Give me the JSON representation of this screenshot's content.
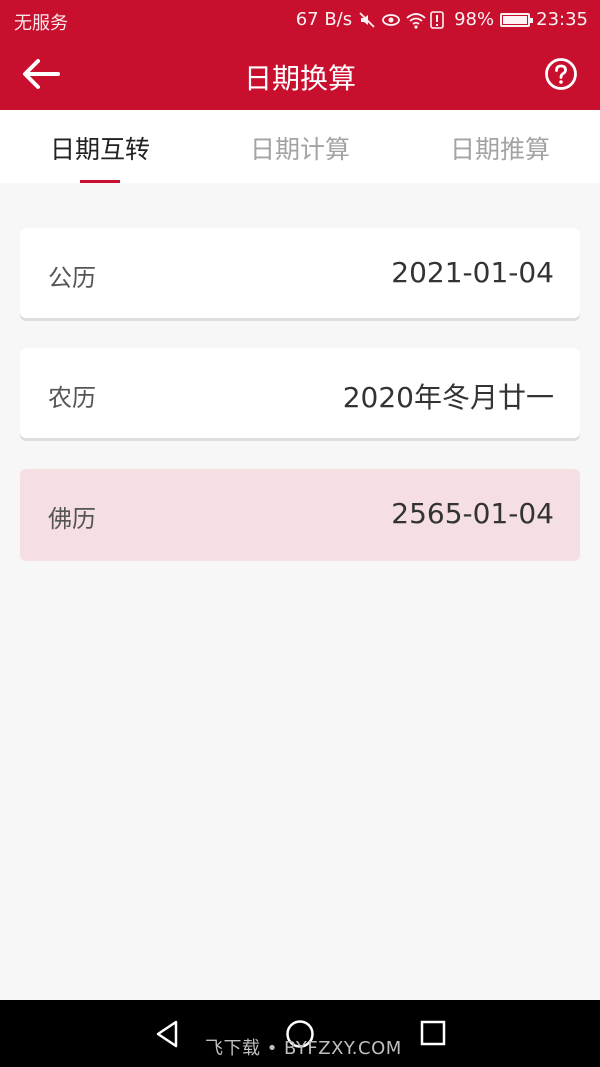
{
  "status_bar": {
    "carrier": "无服务",
    "net_speed": "67 B/s",
    "battery": "98%",
    "battery_level": 0.98,
    "time": "23:35",
    "icons": [
      "mute-icon",
      "eye-icon",
      "wifi-icon",
      "alert-icon"
    ]
  },
  "header": {
    "title": "日期换算",
    "back_icon": "arrow-left-icon",
    "help_icon": "question-circle-icon",
    "bg_color": "#c8102e"
  },
  "tabs": [
    {
      "label": "日期互转",
      "active": true
    },
    {
      "label": "日期计算",
      "active": false
    },
    {
      "label": "日期推算",
      "active": false
    }
  ],
  "rows": [
    {
      "label": "公历",
      "value": "2021-01-04"
    },
    {
      "label": "农历",
      "value": "2020年冬月廿一"
    },
    {
      "label": "佛历",
      "value": "2565-01-04"
    }
  ],
  "nav_bar": {
    "icons": [
      "back-triangle-icon",
      "home-circle-icon",
      "recents-square-icon"
    ]
  },
  "watermark": "飞下载 • BYFZXY.COM"
}
